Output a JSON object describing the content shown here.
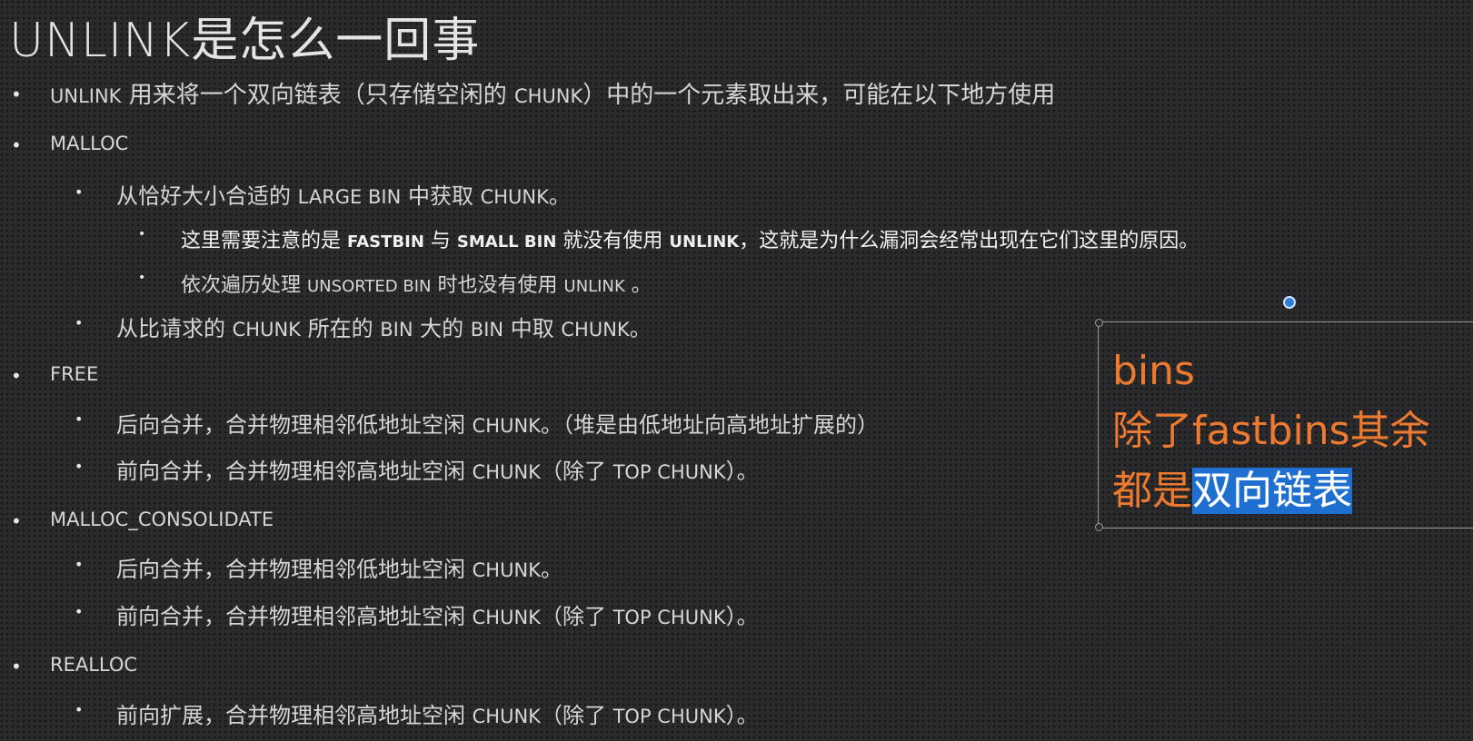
{
  "title": "UNLINK是怎么一回事",
  "bullets": [
    {
      "parts": [
        "UNLINK",
        " 用来将一个双向链表（只存储空闲的 ",
        "CHUNK",
        "）中的一个元素取出来，可能在以下地方使用"
      ]
    },
    {
      "text": "MALLOC"
    },
    {
      "parts": [
        "从恰好大小合适的 ",
        "LARGE BIN",
        " 中获取 ",
        "CHUNK",
        "。"
      ]
    },
    {
      "parts": [
        "这里需要注意的是 ",
        "FASTBIN",
        " 与 ",
        "SMALL BIN",
        " 就没有使用 ",
        "UNLINK",
        "，这就是为什么漏洞会经常出现在它们这里的原因。"
      ]
    },
    {
      "parts": [
        "依次遍历处理 ",
        "UNSORTED BIN",
        " 时也没有使用 ",
        "UNLINK",
        " 。"
      ]
    },
    {
      "parts": [
        "从比请求的 ",
        "CHUNK",
        " 所在的 ",
        "BIN",
        " 大的 ",
        "BIN",
        " 中取 ",
        "CHUNK",
        "。"
      ]
    },
    {
      "text": "FREE"
    },
    {
      "parts": [
        "后向合并，合并物理相邻低地址空闲 ",
        "CHUNK",
        "。（堆是由低地址向高地址扩展的）"
      ]
    },
    {
      "parts": [
        "前向合并，合并物理相邻高地址空闲 ",
        "CHUNK",
        "（除了 ",
        "TOP CHUNK",
        "）。"
      ]
    },
    {
      "text": "MALLOC_CONSOLIDATE"
    },
    {
      "parts": [
        "后向合并，合并物理相邻低地址空闲 ",
        "CHUNK",
        "。"
      ]
    },
    {
      "parts": [
        "前向合并，合并物理相邻高地址空闲 ",
        "CHUNK",
        "（除了 ",
        "TOP CHUNK",
        "）。"
      ]
    },
    {
      "text": "REALLOC"
    },
    {
      "parts": [
        "前向扩展，合并物理相邻高地址空闲 ",
        "CHUNK",
        "（除了 ",
        "TOP CHUNK",
        "）。"
      ]
    }
  ],
  "callout": {
    "line1": "bins",
    "line2": "除了fastbins其余",
    "line3_prefix": "都是",
    "line3_highlight": "双向链表",
    "text_color": "#ee7a30",
    "highlight_color": "#1f6fd1"
  }
}
